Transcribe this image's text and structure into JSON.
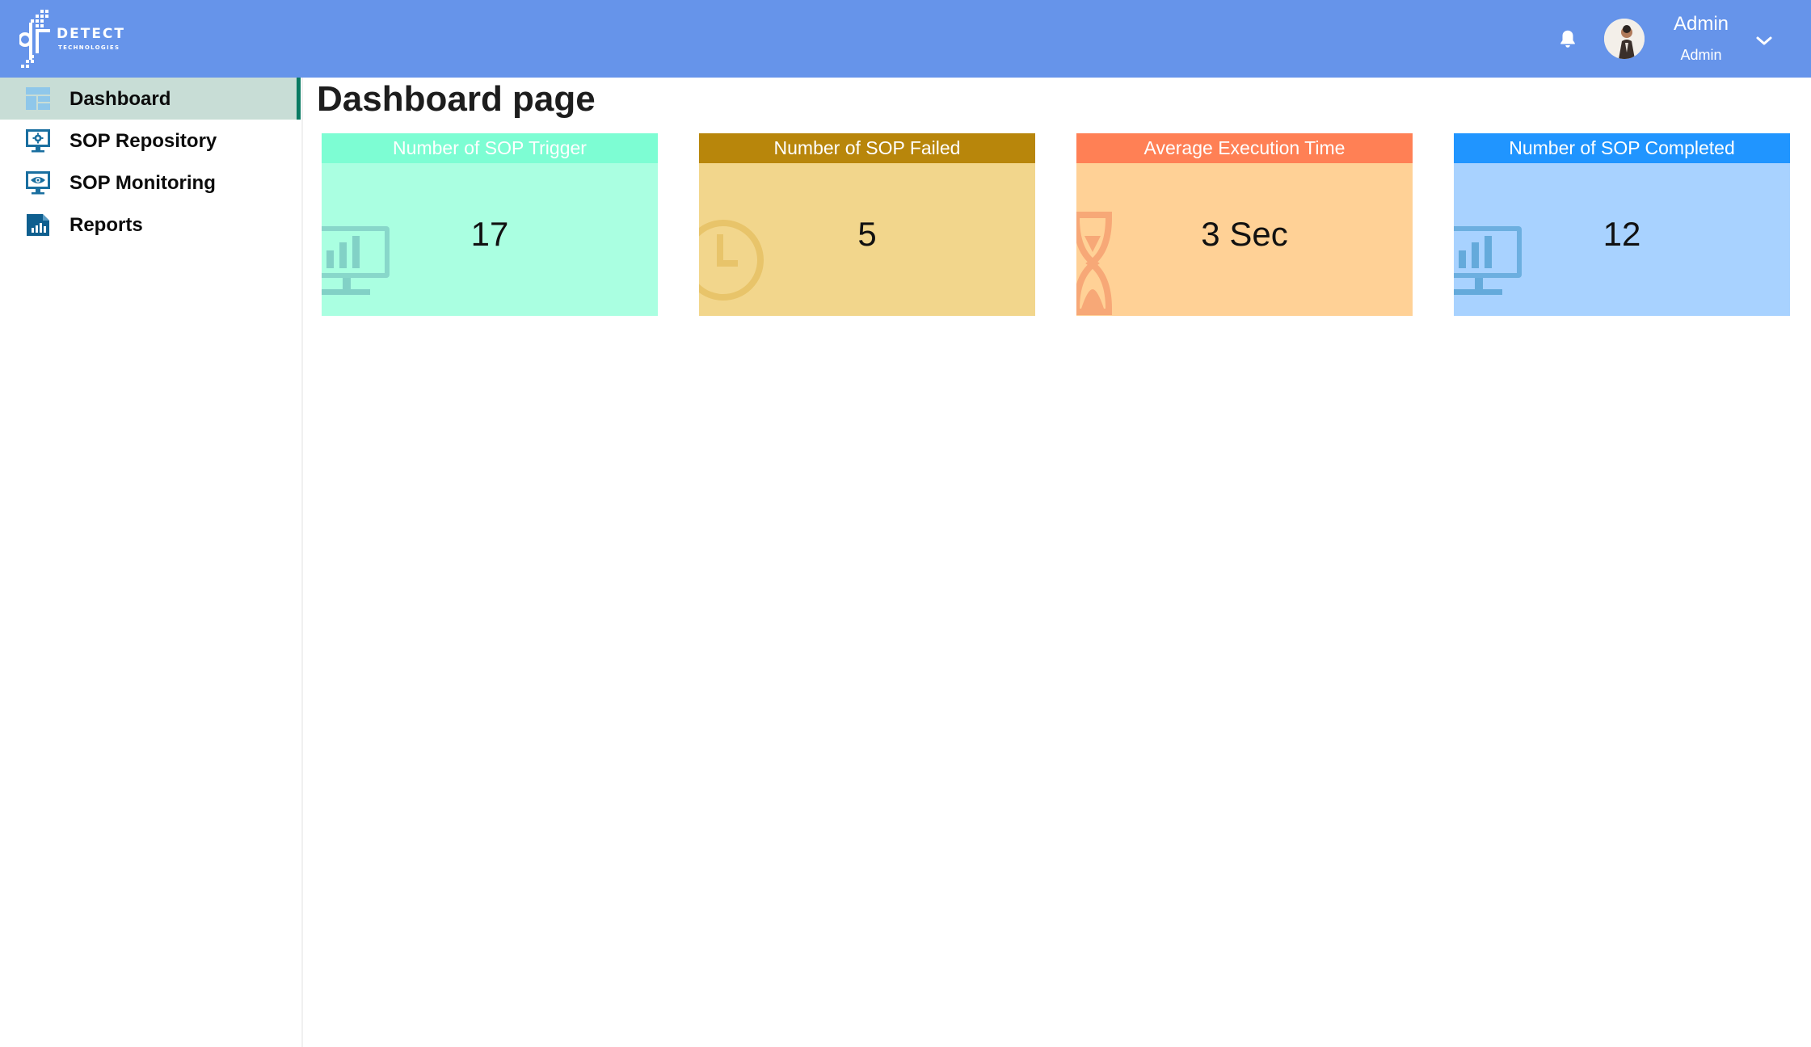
{
  "brand": {
    "word": "DETECT",
    "sub": "TECHNOLOGIES"
  },
  "header": {
    "user_name": "Admin",
    "user_role": "Admin",
    "icons": [
      "bell-icon",
      "avatar",
      "chevron-down-icon"
    ],
    "color": "#6694ea"
  },
  "sidebar": {
    "items": [
      {
        "label": "Dashboard",
        "icon": "dashboard-layout-icon",
        "active": true
      },
      {
        "label": "SOP Repository",
        "icon": "monitor-gear-icon",
        "active": false
      },
      {
        "label": "SOP Monitoring",
        "icon": "monitor-eye-icon",
        "active": false
      },
      {
        "label": "Reports",
        "icon": "report-chart-icon",
        "active": false
      }
    ],
    "active_color": "#0a7a63"
  },
  "main": {
    "title": "Dashboard page",
    "cards": [
      {
        "title": "Number of SOP Trigger",
        "value": "17",
        "icon": "monitor-chart-icon",
        "head_color": "#7dfdd3",
        "body_color": "#aaffe1"
      },
      {
        "title": "Number of SOP Failed",
        "value": "5",
        "icon": "clock-icon",
        "head_color": "#b8860b",
        "body_color": "#f2d68c"
      },
      {
        "title": "Average Execution Time",
        "value": "3 Sec",
        "icon": "hourglass-icon",
        "head_color": "#ff8055",
        "body_color": "#ffd196"
      },
      {
        "title": "Number of SOP Completed",
        "value": "12",
        "icon": "monitor-chart-icon",
        "head_color": "#2095ff",
        "body_color": "#a8d2ff"
      }
    ]
  }
}
